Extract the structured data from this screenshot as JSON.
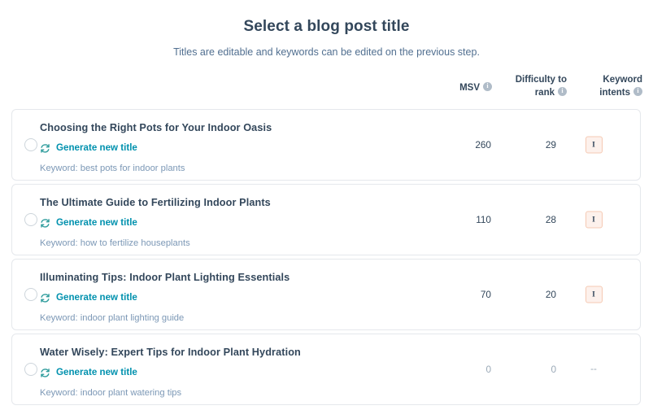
{
  "header": {
    "title": "Select a blog post title",
    "subtitle": "Titles are editable and keywords can be edited on the previous step."
  },
  "columns": {
    "msv": "MSV",
    "difficulty_line1": "Difficulty to",
    "difficulty_line2": "rank",
    "intents_line1": "Keyword",
    "intents_line2": "intents",
    "info_icon": "info-icon"
  },
  "colors": {
    "title": "#33475b",
    "link": "#0091ae",
    "muted": "#7c98b6",
    "badge_border": "#f5c9b3",
    "badge_bg": "#fdf1ec",
    "card_border": "#e5e8ec"
  },
  "regenerate_label": "Generate new title",
  "keyword_prefix": "Keyword:",
  "rows": [
    {
      "title": "Choosing the Right Pots for Your Indoor Oasis",
      "regenerate": "Generate new title",
      "keyword": "Keyword: best pots for indoor plants",
      "msv": "260",
      "difficulty": "29",
      "intent": "I",
      "intent_type": "badge",
      "selected": false
    },
    {
      "title": "The Ultimate Guide to Fertilizing Indoor Plants",
      "regenerate": "Generate new title",
      "keyword": "Keyword: how to fertilize houseplants",
      "msv": "110",
      "difficulty": "28",
      "intent": "I",
      "intent_type": "badge",
      "selected": false
    },
    {
      "title": "Illuminating Tips: Indoor Plant Lighting Essentials",
      "regenerate": "Generate new title",
      "keyword": "Keyword: indoor plant lighting guide",
      "msv": "70",
      "difficulty": "20",
      "intent": "I",
      "intent_type": "badge",
      "selected": false
    },
    {
      "title": "Water Wisely: Expert Tips for Indoor Plant Hydration",
      "regenerate": "Generate new title",
      "keyword": "Keyword: indoor plant watering tips",
      "msv": "0",
      "difficulty": "0",
      "intent": "--",
      "intent_type": "dash",
      "selected": false
    }
  ]
}
